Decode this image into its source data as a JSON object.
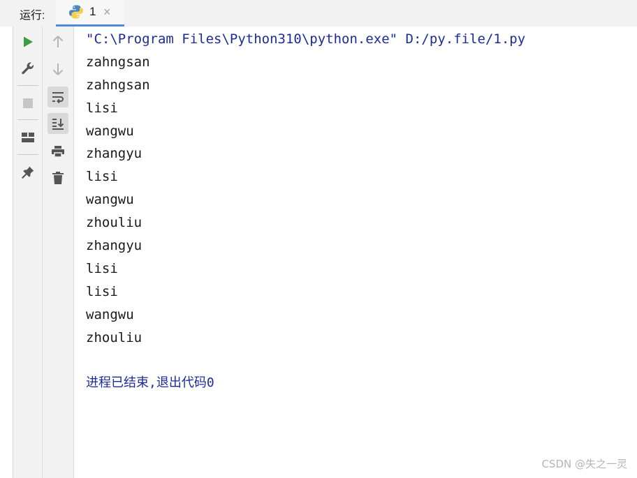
{
  "header": {
    "run_label": "运行:",
    "tab": {
      "label": "1",
      "icon": "python-icon",
      "close": "×"
    }
  },
  "toolbar_left": [
    {
      "name": "run-icon",
      "color": "#3e9d47"
    },
    {
      "name": "wrench-icon"
    },
    {
      "name": "stop-icon"
    },
    {
      "name": "layout-icon"
    },
    {
      "name": "pin-icon"
    }
  ],
  "toolbar_right": [
    {
      "name": "arrow-up-icon"
    },
    {
      "name": "arrow-down-icon"
    },
    {
      "name": "soft-wrap-icon",
      "active": true
    },
    {
      "name": "scroll-to-end-icon",
      "active": true
    },
    {
      "name": "print-icon"
    },
    {
      "name": "trash-icon"
    }
  ],
  "console": {
    "command": "\"C:\\Program Files\\Python310\\python.exe\" D:/py.file/1.py",
    "lines": [
      "zahngsan",
      "zahngsan",
      "lisi",
      "wangwu",
      "zhangyu",
      "lisi",
      "wangwu",
      "zhouliu",
      "zhangyu",
      "lisi",
      "lisi",
      "wangwu",
      "zhouliu"
    ],
    "exit_message": "进程已结束,退出代码0"
  },
  "watermark": "CSDN @失之一灵",
  "colors": {
    "accent": "#4d8cdc",
    "console_blue": "#1b2b9a",
    "run_green": "#3e9d47"
  }
}
